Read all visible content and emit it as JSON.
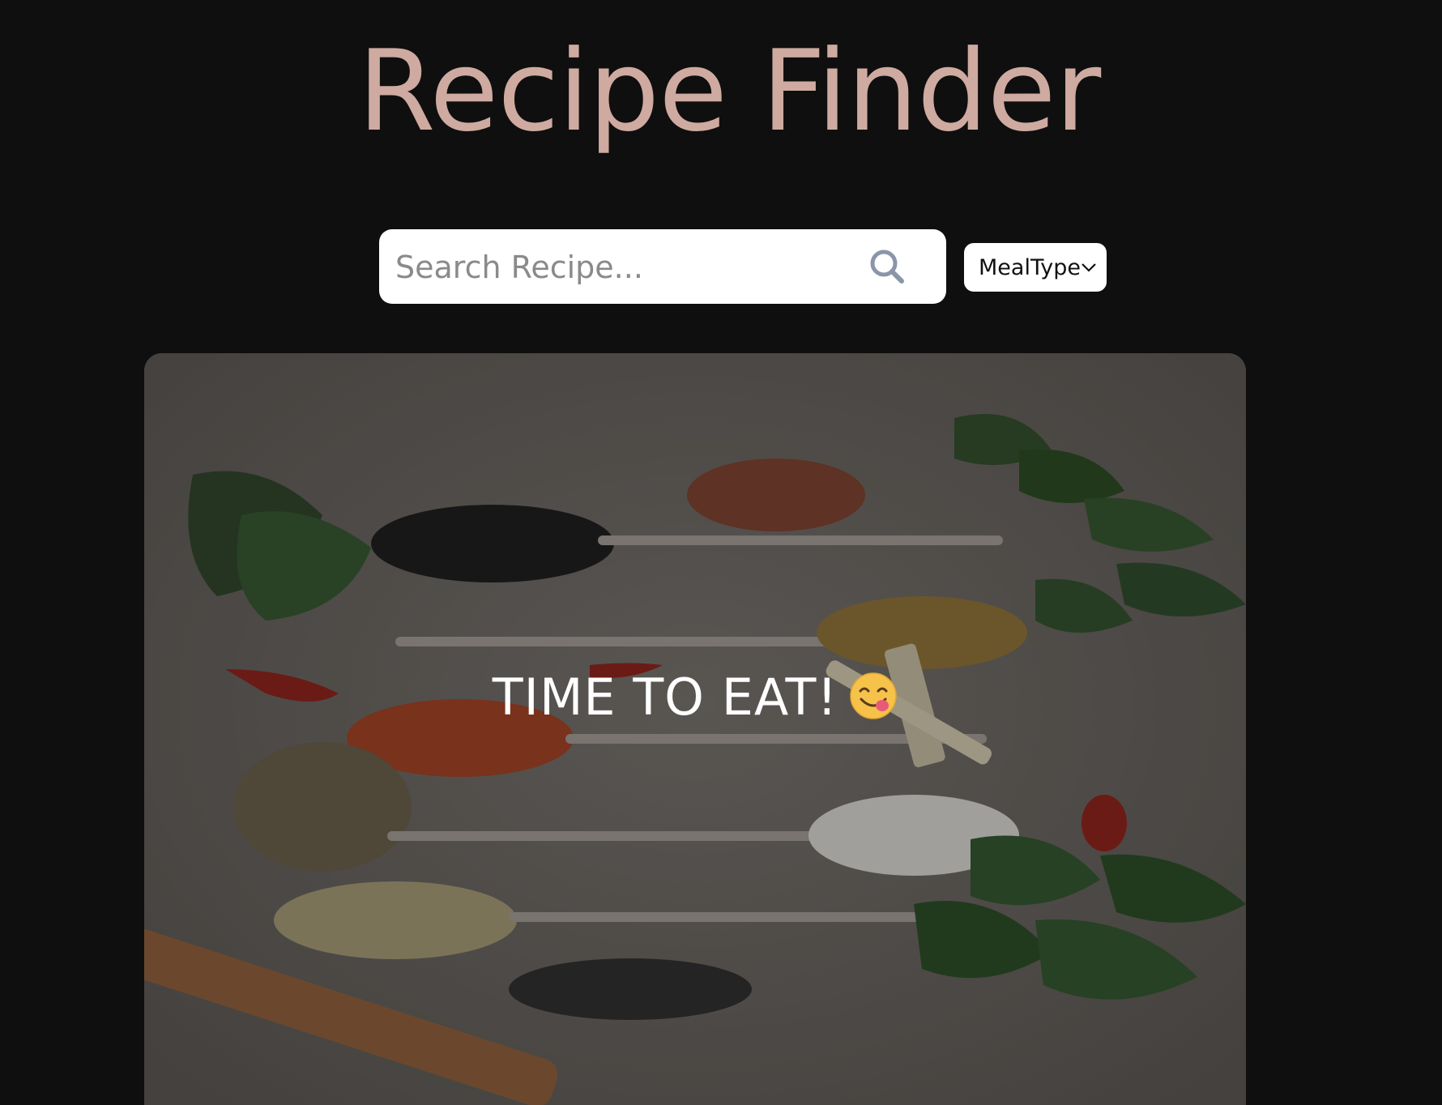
{
  "header": {
    "title": "Recipe Finder"
  },
  "search": {
    "placeholder": "Search Recipe...",
    "value": "",
    "icon": "search-icon"
  },
  "filter": {
    "selected": "MealType",
    "icon": "chevron-down-icon"
  },
  "hero": {
    "text": "TIME TO EAT!",
    "emoji_icon": "yum-face-emoji-icon",
    "image": "spices-on-spoons"
  },
  "colors": {
    "background": "#0f0f0f",
    "title": "#cfaaa0",
    "search_bg": "#ffffff",
    "search_icon": "#8a96a8"
  }
}
